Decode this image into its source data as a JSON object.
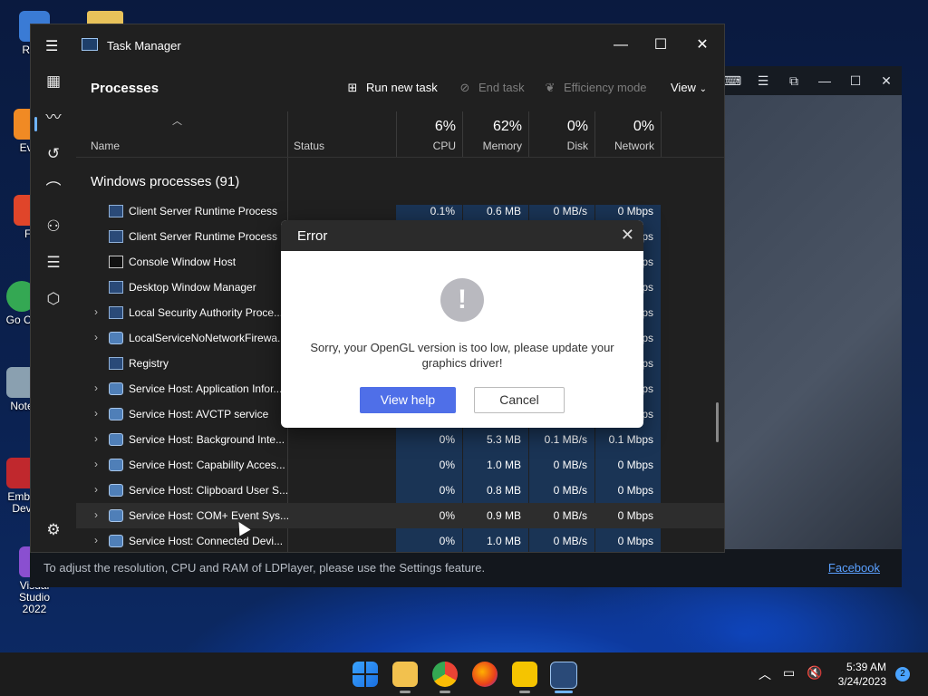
{
  "desktop": {
    "icons": [
      {
        "label": "Recy",
        "color": "#3a7bd5"
      },
      {
        "label": "Eve",
        "color": "#f08a24"
      },
      {
        "label": "Fi",
        "color": "#e0452a"
      },
      {
        "label": "Go Ch",
        "color": "#34a853"
      },
      {
        "label": "Note",
        "color": "#8aa0b0"
      },
      {
        "label": "Emba Dev",
        "color": "#c0282d"
      },
      {
        "label": "Visual Studio 2022",
        "color": "#8a4fd0"
      }
    ]
  },
  "ldplayer": {
    "message": "To adjust the resolution, CPU and RAM of LDPlayer, please use the Settings feature.",
    "link": "Facebook"
  },
  "task_manager": {
    "title": "Task Manager",
    "page_title": "Processes",
    "toolbar": {
      "run_new_task": "Run new task",
      "end_task": "End task",
      "efficiency_mode": "Efficiency mode",
      "view": "View"
    },
    "columns": {
      "name": "Name",
      "status": "Status",
      "cpu_pct": "6%",
      "cpu": "CPU",
      "memory_pct": "62%",
      "memory": "Memory",
      "disk_pct": "0%",
      "disk": "Disk",
      "network_pct": "0%",
      "network": "Network"
    },
    "group_label": "Windows processes (91)",
    "rows": [
      {
        "name": "Client Server Runtime Process",
        "expand": false,
        "icon": "app-window-icon",
        "cpu": "0.1%",
        "memory": "0.6 MB",
        "disk": "0 MB/s",
        "network": "0 Mbps"
      },
      {
        "name": "Client Server Runtime Process",
        "expand": false,
        "icon": "app-window-icon",
        "cpu": "",
        "memory": "",
        "disk": "",
        "network": "ps"
      },
      {
        "name": "Console Window Host",
        "expand": false,
        "icon": "console-icon",
        "cpu": "",
        "memory": "",
        "disk": "",
        "network": "ps"
      },
      {
        "name": "Desktop Window Manager",
        "expand": false,
        "icon": "app-window-icon",
        "cpu": "",
        "memory": "",
        "disk": "",
        "network": "ps"
      },
      {
        "name": "Local Security Authority Proce...",
        "expand": true,
        "icon": "app-window-icon",
        "cpu": "",
        "memory": "",
        "disk": "",
        "network": "ps"
      },
      {
        "name": "LocalServiceNoNetworkFirewa...",
        "expand": true,
        "icon": "service-gear-icon",
        "cpu": "",
        "memory": "",
        "disk": "",
        "network": "ps"
      },
      {
        "name": "Registry",
        "expand": false,
        "icon": "app-window-icon",
        "cpu": "",
        "memory": "",
        "disk": "",
        "network": "ps"
      },
      {
        "name": "Service Host: Application Infor...",
        "expand": true,
        "icon": "service-gear-icon",
        "cpu": "",
        "memory": "",
        "disk": "",
        "network": "ps"
      },
      {
        "name": "Service Host: AVCTP service",
        "expand": true,
        "icon": "service-gear-icon",
        "cpu": "",
        "memory": "",
        "disk": "",
        "network": "ps"
      },
      {
        "name": "Service Host: Background Inte...",
        "expand": true,
        "icon": "service-gear-icon",
        "cpu": "0%",
        "memory": "5.3 MB",
        "disk": "0.1 MB/s",
        "network": "0.1 Mbps"
      },
      {
        "name": "Service Host: Capability Acces...",
        "expand": true,
        "icon": "service-gear-icon",
        "cpu": "0%",
        "memory": "1.0 MB",
        "disk": "0 MB/s",
        "network": "0 Mbps"
      },
      {
        "name": "Service Host: Clipboard User S...",
        "expand": true,
        "icon": "service-gear-icon",
        "cpu": "0%",
        "memory": "0.8 MB",
        "disk": "0 MB/s",
        "network": "0 Mbps"
      },
      {
        "name": "Service Host: COM+ Event Sys...",
        "expand": true,
        "icon": "service-gear-icon",
        "cpu": "0%",
        "memory": "0.9 MB",
        "disk": "0 MB/s",
        "network": "0 Mbps"
      },
      {
        "name": "Service Host: Connected Devi...",
        "expand": true,
        "icon": "service-gear-icon",
        "cpu": "0%",
        "memory": "1.0 MB",
        "disk": "0 MB/s",
        "network": "0 Mbps"
      }
    ]
  },
  "dialog": {
    "title": "Error",
    "message": "Sorry, your OpenGL version is too low, please update your graphics driver!",
    "primary_button": "View help",
    "secondary_button": "Cancel"
  },
  "taskbar": {
    "time": "5:39 AM",
    "date": "3/24/2023",
    "notification_count": "2",
    "apps": [
      "start-icon",
      "file-explorer-icon",
      "chrome-icon",
      "firefox-icon",
      "ldplayer-icon",
      "task-manager-icon"
    ]
  },
  "colors": {
    "accent": "#4f6fe8",
    "heat": "#1a3455",
    "link": "#5aa0ff"
  }
}
